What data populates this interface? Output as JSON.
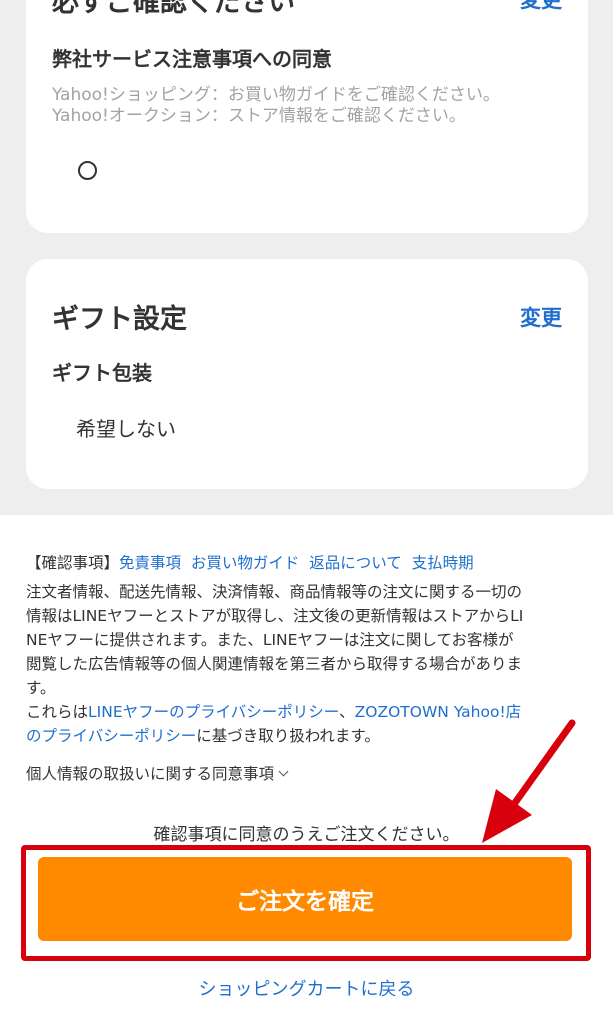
{
  "consent_card": {
    "heading": "必ずご確認ください",
    "change_label": "変更",
    "subheading": "弊社サービス注意事項への同意",
    "notes": [
      "Yahoo!ショッピング：お買い物ガイドをご確認ください。",
      "Yahoo!オークション：ストア情報をご確認ください。"
    ]
  },
  "gift_card": {
    "heading": "ギフト設定",
    "change_label": "変更",
    "subheading": "ギフト包装",
    "value": "希望しない"
  },
  "confirmation": {
    "prefix": "【確認事項】",
    "links": [
      "免責事項",
      "お買い物ガイド",
      "返品について",
      "支払時期"
    ],
    "body_lines": [
      "注文者情報、配送先情報、決済情報、商品情報等の注文に関する一切の",
      "情報はLINEヤフーとストアが取得し、注文後の更新情報はストアからLI",
      "NEヤフーに提供されます。また、LINEヤフーは注文に関してお客様が",
      "閲覧した広告情報等の個人関連情報を第三者から取得する場合がありま",
      "す。"
    ],
    "policy_line1_prefix": "これらは",
    "policy_link1": "LINEヤフーのプライバシーポリシー",
    "policy_separator": "、",
    "policy_link2_part1": "ZOZOTOWN Yahoo!店",
    "policy_link2_part2": "のプライバシーポリシー",
    "policy_suffix": "に基づき取り扱われます。",
    "privacy_toggle_label": "個人情報の取扱いに関する同意事項"
  },
  "agree_note": "確認事項に同意のうえご注文ください。",
  "order_button_label": "ご注文を確定",
  "back_link_label": "ショッピングカートに戻る",
  "colors": {
    "primary_button": "#ff8a00",
    "link": "#1f6fcf",
    "highlight": "#d9000e",
    "background": "#eeeeee"
  }
}
